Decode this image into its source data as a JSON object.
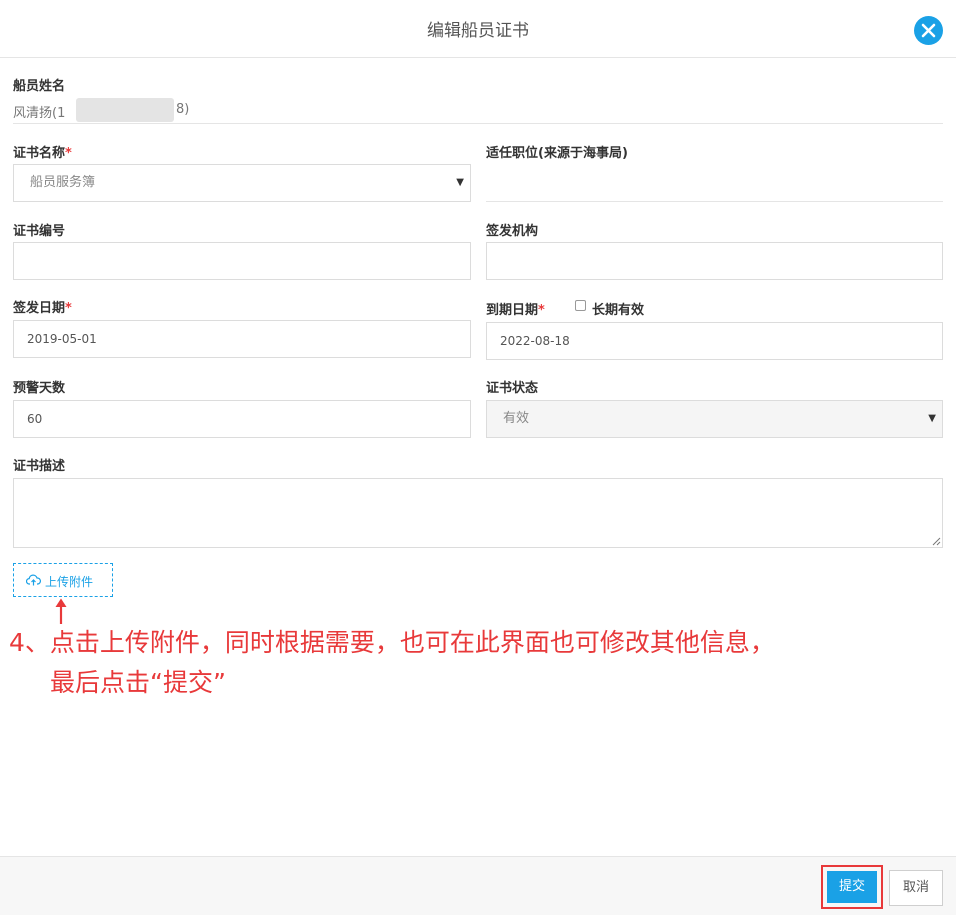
{
  "dialog": {
    "title": "编辑船员证书",
    "close_icon": "close-icon"
  },
  "colors": {
    "accent": "#1aa1e6",
    "required": "#e8393a",
    "annotation": "#e8393a"
  },
  "crew": {
    "label": "船员姓名",
    "value_prefix": "风清扬(1",
    "value_suffix": "8)"
  },
  "fields": {
    "cert_name": {
      "label": "证书名称",
      "required": "*",
      "value": "船员服务簿"
    },
    "position": {
      "label": "适任职位(来源于海事局)"
    },
    "cert_number": {
      "label": "证书编号",
      "value": ""
    },
    "issuer": {
      "label": "签发机构",
      "value": ""
    },
    "issue_date": {
      "label": "签发日期",
      "required": "*",
      "value": "2019-05-01"
    },
    "expiry_date": {
      "label": "到期日期",
      "required": "*",
      "value": "2022-08-18",
      "long_term_label": "长期有效",
      "long_term_checked": false
    },
    "warning_days": {
      "label": "预警天数",
      "value": "60"
    },
    "status": {
      "label": "证书状态",
      "value": "有效"
    },
    "description": {
      "label": "证书描述",
      "value": ""
    }
  },
  "upload": {
    "label": "上传附件",
    "icon": "cloud-upload-icon"
  },
  "annotation": {
    "line1": "4、点击上传附件，同时根据需要，也可在此界面也可修改其他信息，",
    "line2": "最后点击“提交”"
  },
  "footer": {
    "submit_label": "提交",
    "cancel_label": "取消"
  }
}
